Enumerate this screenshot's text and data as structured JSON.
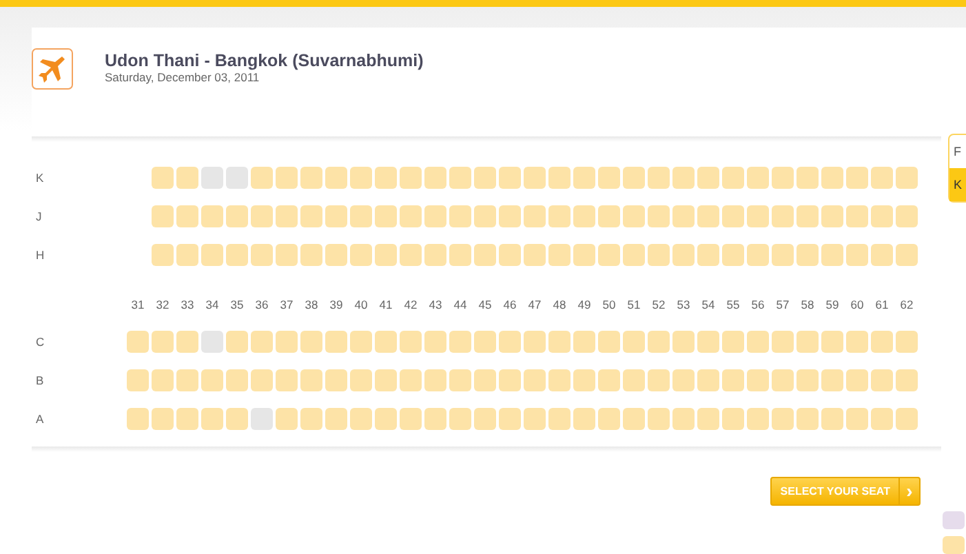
{
  "flight": {
    "title": "Udon Thani - Bangkok (Suvarnabhumi)",
    "date": "Saturday, December 03, 2011"
  },
  "side_tabs": [
    {
      "label": "F",
      "selected": false
    },
    {
      "label": "K",
      "selected": true
    }
  ],
  "upper_rows": [
    {
      "label": "K",
      "seats": [
        {
          "kind": "gap"
        },
        {
          "kind": "seat",
          "available": true
        },
        {
          "kind": "seat",
          "available": true
        },
        {
          "kind": "seat",
          "available": false
        },
        {
          "kind": "seat",
          "available": false
        },
        {
          "kind": "seat",
          "available": true
        },
        {
          "kind": "seat",
          "available": true
        },
        {
          "kind": "seat",
          "available": true
        },
        {
          "kind": "seat",
          "available": true
        },
        {
          "kind": "seat",
          "available": true
        },
        {
          "kind": "seat",
          "available": true
        },
        {
          "kind": "seat",
          "available": true
        },
        {
          "kind": "seat",
          "available": true
        },
        {
          "kind": "seat",
          "available": true
        },
        {
          "kind": "seat",
          "available": true
        },
        {
          "kind": "seat",
          "available": true
        },
        {
          "kind": "seat",
          "available": true
        },
        {
          "kind": "seat",
          "available": true
        },
        {
          "kind": "seat",
          "available": true
        },
        {
          "kind": "seat",
          "available": true
        },
        {
          "kind": "seat",
          "available": true
        },
        {
          "kind": "seat",
          "available": true
        },
        {
          "kind": "seat",
          "available": true
        },
        {
          "kind": "seat",
          "available": true
        },
        {
          "kind": "seat",
          "available": true
        },
        {
          "kind": "seat",
          "available": true
        },
        {
          "kind": "seat",
          "available": true
        },
        {
          "kind": "seat",
          "available": true
        },
        {
          "kind": "seat",
          "available": true
        },
        {
          "kind": "seat",
          "available": true
        },
        {
          "kind": "seat",
          "available": true
        },
        {
          "kind": "seat",
          "available": true
        }
      ]
    },
    {
      "label": "J",
      "seats": [
        {
          "kind": "gap"
        },
        {
          "kind": "seat",
          "available": true
        },
        {
          "kind": "seat",
          "available": true
        },
        {
          "kind": "seat",
          "available": true
        },
        {
          "kind": "seat",
          "available": true
        },
        {
          "kind": "seat",
          "available": true
        },
        {
          "kind": "seat",
          "available": true
        },
        {
          "kind": "seat",
          "available": true
        },
        {
          "kind": "seat",
          "available": true
        },
        {
          "kind": "seat",
          "available": true
        },
        {
          "kind": "seat",
          "available": true
        },
        {
          "kind": "seat",
          "available": true
        },
        {
          "kind": "seat",
          "available": true
        },
        {
          "kind": "seat",
          "available": true
        },
        {
          "kind": "seat",
          "available": true
        },
        {
          "kind": "seat",
          "available": true
        },
        {
          "kind": "seat",
          "available": true
        },
        {
          "kind": "seat",
          "available": true
        },
        {
          "kind": "seat",
          "available": true
        },
        {
          "kind": "seat",
          "available": true
        },
        {
          "kind": "seat",
          "available": true
        },
        {
          "kind": "seat",
          "available": true
        },
        {
          "kind": "seat",
          "available": true
        },
        {
          "kind": "seat",
          "available": true
        },
        {
          "kind": "seat",
          "available": true
        },
        {
          "kind": "seat",
          "available": true
        },
        {
          "kind": "seat",
          "available": true
        },
        {
          "kind": "seat",
          "available": true
        },
        {
          "kind": "seat",
          "available": true
        },
        {
          "kind": "seat",
          "available": true
        },
        {
          "kind": "seat",
          "available": true
        },
        {
          "kind": "seat",
          "available": true
        }
      ]
    },
    {
      "label": "H",
      "seats": [
        {
          "kind": "gap"
        },
        {
          "kind": "seat",
          "available": true
        },
        {
          "kind": "seat",
          "available": true
        },
        {
          "kind": "seat",
          "available": true
        },
        {
          "kind": "seat",
          "available": true
        },
        {
          "kind": "seat",
          "available": true
        },
        {
          "kind": "seat",
          "available": true
        },
        {
          "kind": "seat",
          "available": true
        },
        {
          "kind": "seat",
          "available": true
        },
        {
          "kind": "seat",
          "available": true
        },
        {
          "kind": "seat",
          "available": true
        },
        {
          "kind": "seat",
          "available": true
        },
        {
          "kind": "seat",
          "available": true
        },
        {
          "kind": "seat",
          "available": true
        },
        {
          "kind": "seat",
          "available": true
        },
        {
          "kind": "seat",
          "available": true
        },
        {
          "kind": "seat",
          "available": true
        },
        {
          "kind": "seat",
          "available": true
        },
        {
          "kind": "seat",
          "available": true
        },
        {
          "kind": "seat",
          "available": true
        },
        {
          "kind": "seat",
          "available": true
        },
        {
          "kind": "seat",
          "available": true
        },
        {
          "kind": "seat",
          "available": true
        },
        {
          "kind": "seat",
          "available": true
        },
        {
          "kind": "seat",
          "available": true
        },
        {
          "kind": "seat",
          "available": true
        },
        {
          "kind": "seat",
          "available": true
        },
        {
          "kind": "seat",
          "available": true
        },
        {
          "kind": "seat",
          "available": true
        },
        {
          "kind": "seat",
          "available": true
        },
        {
          "kind": "seat",
          "available": true
        },
        {
          "kind": "seat",
          "available": true
        }
      ]
    }
  ],
  "row_numbers": [
    "31",
    "32",
    "33",
    "34",
    "35",
    "36",
    "37",
    "38",
    "39",
    "40",
    "41",
    "42",
    "43",
    "44",
    "45",
    "46",
    "47",
    "48",
    "49",
    "50",
    "51",
    "52",
    "53",
    "54",
    "55",
    "56",
    "57",
    "58",
    "59",
    "60",
    "61",
    "62"
  ],
  "lower_rows": [
    {
      "label": "C",
      "seats": [
        {
          "kind": "seat",
          "available": true
        },
        {
          "kind": "seat",
          "available": true
        },
        {
          "kind": "seat",
          "available": true
        },
        {
          "kind": "seat",
          "available": false
        },
        {
          "kind": "seat",
          "available": true
        },
        {
          "kind": "seat",
          "available": true
        },
        {
          "kind": "seat",
          "available": true
        },
        {
          "kind": "seat",
          "available": true
        },
        {
          "kind": "seat",
          "available": true
        },
        {
          "kind": "seat",
          "available": true
        },
        {
          "kind": "seat",
          "available": true
        },
        {
          "kind": "seat",
          "available": true
        },
        {
          "kind": "seat",
          "available": true
        },
        {
          "kind": "seat",
          "available": true
        },
        {
          "kind": "seat",
          "available": true
        },
        {
          "kind": "seat",
          "available": true
        },
        {
          "kind": "seat",
          "available": true
        },
        {
          "kind": "seat",
          "available": true
        },
        {
          "kind": "seat",
          "available": true
        },
        {
          "kind": "seat",
          "available": true
        },
        {
          "kind": "seat",
          "available": true
        },
        {
          "kind": "seat",
          "available": true
        },
        {
          "kind": "seat",
          "available": true
        },
        {
          "kind": "seat",
          "available": true
        },
        {
          "kind": "seat",
          "available": true
        },
        {
          "kind": "seat",
          "available": true
        },
        {
          "kind": "seat",
          "available": true
        },
        {
          "kind": "seat",
          "available": true
        },
        {
          "kind": "seat",
          "available": true
        },
        {
          "kind": "seat",
          "available": true
        },
        {
          "kind": "seat",
          "available": true
        },
        {
          "kind": "seat",
          "available": true
        }
      ]
    },
    {
      "label": "B",
      "seats": [
        {
          "kind": "seat",
          "available": true
        },
        {
          "kind": "seat",
          "available": true
        },
        {
          "kind": "seat",
          "available": true
        },
        {
          "kind": "seat",
          "available": true
        },
        {
          "kind": "seat",
          "available": true
        },
        {
          "kind": "seat",
          "available": true
        },
        {
          "kind": "seat",
          "available": true
        },
        {
          "kind": "seat",
          "available": true
        },
        {
          "kind": "seat",
          "available": true
        },
        {
          "kind": "seat",
          "available": true
        },
        {
          "kind": "seat",
          "available": true
        },
        {
          "kind": "seat",
          "available": true
        },
        {
          "kind": "seat",
          "available": true
        },
        {
          "kind": "seat",
          "available": true
        },
        {
          "kind": "seat",
          "available": true
        },
        {
          "kind": "seat",
          "available": true
        },
        {
          "kind": "seat",
          "available": true
        },
        {
          "kind": "seat",
          "available": true
        },
        {
          "kind": "seat",
          "available": true
        },
        {
          "kind": "seat",
          "available": true
        },
        {
          "kind": "seat",
          "available": true
        },
        {
          "kind": "seat",
          "available": true
        },
        {
          "kind": "seat",
          "available": true
        },
        {
          "kind": "seat",
          "available": true
        },
        {
          "kind": "seat",
          "available": true
        },
        {
          "kind": "seat",
          "available": true
        },
        {
          "kind": "seat",
          "available": true
        },
        {
          "kind": "seat",
          "available": true
        },
        {
          "kind": "seat",
          "available": true
        },
        {
          "kind": "seat",
          "available": true
        },
        {
          "kind": "seat",
          "available": true
        },
        {
          "kind": "seat",
          "available": true
        }
      ]
    },
    {
      "label": "A",
      "seats": [
        {
          "kind": "seat",
          "available": true
        },
        {
          "kind": "seat",
          "available": true
        },
        {
          "kind": "seat",
          "available": true
        },
        {
          "kind": "seat",
          "available": true
        },
        {
          "kind": "seat",
          "available": true
        },
        {
          "kind": "seat",
          "available": false
        },
        {
          "kind": "seat",
          "available": true
        },
        {
          "kind": "seat",
          "available": true
        },
        {
          "kind": "seat",
          "available": true
        },
        {
          "kind": "seat",
          "available": true
        },
        {
          "kind": "seat",
          "available": true
        },
        {
          "kind": "seat",
          "available": true
        },
        {
          "kind": "seat",
          "available": true
        },
        {
          "kind": "seat",
          "available": true
        },
        {
          "kind": "seat",
          "available": true
        },
        {
          "kind": "seat",
          "available": true
        },
        {
          "kind": "seat",
          "available": true
        },
        {
          "kind": "seat",
          "available": true
        },
        {
          "kind": "seat",
          "available": true
        },
        {
          "kind": "seat",
          "available": true
        },
        {
          "kind": "seat",
          "available": true
        },
        {
          "kind": "seat",
          "available": true
        },
        {
          "kind": "seat",
          "available": true
        },
        {
          "kind": "seat",
          "available": true
        },
        {
          "kind": "seat",
          "available": true
        },
        {
          "kind": "seat",
          "available": true
        },
        {
          "kind": "seat",
          "available": true
        },
        {
          "kind": "seat",
          "available": true
        },
        {
          "kind": "seat",
          "available": true
        },
        {
          "kind": "seat",
          "available": true
        },
        {
          "kind": "seat",
          "available": true
        },
        {
          "kind": "seat",
          "available": true
        }
      ]
    }
  ],
  "legend": [
    {
      "color": "#e6dcec"
    },
    {
      "color": "#fde3a7"
    }
  ],
  "select_button": {
    "label": "SELECT YOUR SEAT",
    "arrow": "›"
  }
}
